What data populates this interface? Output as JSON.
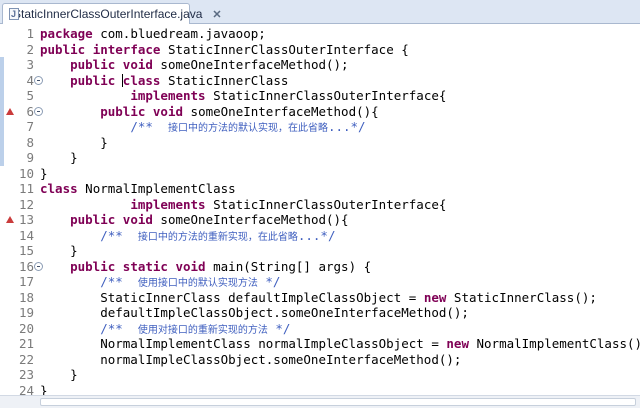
{
  "tab": {
    "title": "StaticInnerClassOuterInterface.java",
    "close": "✕",
    "icon": "java-file-icon"
  },
  "gutter": {
    "line_numbers": [
      "1",
      "2",
      "3",
      "4",
      "5",
      "6",
      "7",
      "8",
      "9",
      "10",
      "11",
      "12",
      "13",
      "14",
      "15",
      "16",
      "17",
      "18",
      "19",
      "20",
      "21",
      "22",
      "23",
      "24"
    ]
  },
  "code": {
    "lines": [
      [
        [
          "kw",
          "package"
        ],
        [
          "t",
          " com.bluedream.javaoop;"
        ]
      ],
      [
        [
          "kw",
          "public"
        ],
        [
          "t",
          " "
        ],
        [
          "kw",
          "interface"
        ],
        [
          "t",
          " StaticInnerClassOuterInterface {"
        ]
      ],
      [
        [
          "t",
          "    "
        ],
        [
          "kw",
          "public"
        ],
        [
          "t",
          " "
        ],
        [
          "kw",
          "void"
        ],
        [
          "t",
          " someOneInterfaceMethod();"
        ]
      ],
      [
        [
          "t",
          "    "
        ],
        [
          "kw",
          "public"
        ],
        [
          "t",
          " "
        ],
        [
          "caret",
          ""
        ],
        [
          "kw",
          "class"
        ],
        [
          "t",
          " StaticInnerClass"
        ]
      ],
      [
        [
          "t",
          "            "
        ],
        [
          "kw",
          "implements"
        ],
        [
          "t",
          " StaticInnerClassOuterInterface{"
        ]
      ],
      [
        [
          "t",
          "        "
        ],
        [
          "kw",
          "public"
        ],
        [
          "t",
          " "
        ],
        [
          "kw",
          "void"
        ],
        [
          "t",
          " someOneInterfaceMethod(){"
        ]
      ],
      [
        [
          "t",
          "            "
        ],
        [
          "cm",
          "/**  "
        ],
        [
          "cmzh",
          "接口中的方法的默认实现，在此省略"
        ],
        [
          "cm",
          "...*/"
        ]
      ],
      [
        [
          "t",
          "        }"
        ]
      ],
      [
        [
          "t",
          "    }"
        ]
      ],
      [
        [
          "t",
          "}"
        ]
      ],
      [
        [
          "kw",
          "class"
        ],
        [
          "t",
          " NormalImplementClass"
        ]
      ],
      [
        [
          "t",
          "            "
        ],
        [
          "kw",
          "implements"
        ],
        [
          "t",
          " StaticInnerClassOuterInterface{"
        ]
      ],
      [
        [
          "t",
          "    "
        ],
        [
          "kw",
          "public"
        ],
        [
          "t",
          " "
        ],
        [
          "kw",
          "void"
        ],
        [
          "t",
          " someOneInterfaceMethod(){"
        ]
      ],
      [
        [
          "t",
          "        "
        ],
        [
          "cm",
          "/**  "
        ],
        [
          "cmzh",
          "接口中的方法的重新实现，在此省略"
        ],
        [
          "cm",
          "...*/"
        ]
      ],
      [
        [
          "t",
          "    }"
        ]
      ],
      [
        [
          "t",
          "    "
        ],
        [
          "kw",
          "public"
        ],
        [
          "t",
          " "
        ],
        [
          "kw",
          "static"
        ],
        [
          "t",
          " "
        ],
        [
          "kw",
          "void"
        ],
        [
          "t",
          " main(String[] args) {"
        ]
      ],
      [
        [
          "t",
          "        "
        ],
        [
          "cm",
          "/**  "
        ],
        [
          "cmzh",
          "使用接口中的默认实现方法"
        ],
        [
          "cm",
          " */"
        ]
      ],
      [
        [
          "t",
          "        StaticInnerClass defaultImpleClassObject = "
        ],
        [
          "kw",
          "new"
        ],
        [
          "t",
          " StaticInnerClass();"
        ]
      ],
      [
        [
          "t",
          "        defaultImpleClassObject.someOneInterfaceMethod();"
        ]
      ],
      [
        [
          "t",
          "        "
        ],
        [
          "cm",
          "/**  "
        ],
        [
          "cmzh",
          "使用对接口的重新实现的方法"
        ],
        [
          "cm",
          " */"
        ]
      ],
      [
        [
          "t",
          "        NormalImplementClass normalImpleClassObject = "
        ],
        [
          "kw",
          "new"
        ],
        [
          "t",
          " NormalImplementClass();"
        ]
      ],
      [
        [
          "t",
          "        normalImpleClassObject.someOneInterfaceMethod();"
        ]
      ],
      [
        [
          "t",
          "    }"
        ]
      ],
      [
        [
          "t",
          "}"
        ]
      ]
    ]
  },
  "markers": {
    "fold_lines": [
      4,
      6,
      16
    ],
    "override_lines": [
      6,
      13
    ],
    "ruler_ranges": [
      [
        3,
        9
      ]
    ]
  },
  "colors": {
    "keyword": "#7f0055",
    "comment": "#3f5fbf",
    "text": "#000000",
    "tab_bar": "#dde6f3"
  }
}
